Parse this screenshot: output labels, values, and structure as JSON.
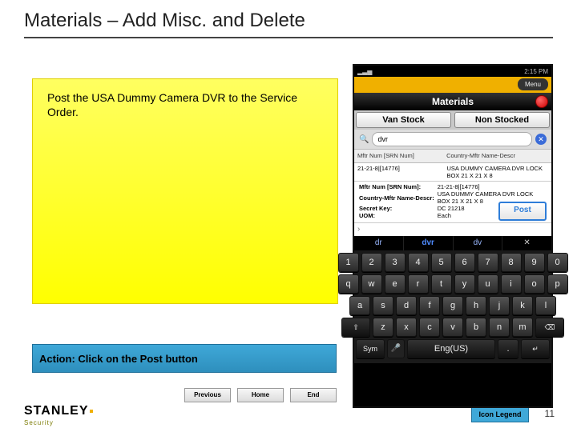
{
  "title": "Materials – Add Misc. and Delete",
  "instruction": "Post the USA Dummy Camera DVR to the Service Order.",
  "action": "Action:  Click on the Post button",
  "nav": {
    "prev": "Previous",
    "home": "Home",
    "end": "End"
  },
  "brand": {
    "name": "STANLEY",
    "sub": "Security"
  },
  "iconLegend": "Icon Legend",
  "pageNum": "11",
  "phone": {
    "time": "2:15 PM",
    "menu": "Menu",
    "header": "Materials",
    "tabs": {
      "van": "Van Stock",
      "non": "Non Stocked"
    },
    "search": {
      "placeholder": "",
      "value": "dvr"
    },
    "cols": {
      "left": "Mftr Num [SRN Num]",
      "right": "Country-Mftr Name-Descr"
    },
    "row": {
      "left": "21-21-8|[14776]",
      "right": "USA DUMMY CAMERA DVR LOCK BOX 21 X 21 X 8"
    },
    "details": {
      "mftr_k": "Mftr Num [SRN Num]:",
      "mftr_v": "21-21-8|[14776]",
      "cmnd_k": "Country-Mftr Name-Descr:",
      "cmnd_v": "USA DUMMY CAMERA DVR LOCK BOX 21 X 21 X 8",
      "secret_k": "Secret Key:",
      "secret_v": "DC 21218",
      "uom_k": "UOM:",
      "uom_v": "Each"
    },
    "post": "Post",
    "suggest": {
      "a": "dr",
      "b": "dvr",
      "c": "dv"
    },
    "kb": {
      "r1": [
        "1",
        "2",
        "3",
        "4",
        "5",
        "6",
        "7",
        "8",
        "9",
        "0"
      ],
      "r2": [
        "q",
        "w",
        "e",
        "r",
        "t",
        "y",
        "u",
        "i",
        "o",
        "p"
      ],
      "r3": [
        "a",
        "s",
        "d",
        "f",
        "g",
        "h",
        "j",
        "k",
        "l"
      ],
      "shift": "⇧",
      "r4": [
        "z",
        "x",
        "c",
        "v",
        "b",
        "n",
        "m"
      ],
      "del": "⌫",
      "sym": "Sym",
      "lang": "Eng(US)",
      "enter": "↵"
    }
  }
}
